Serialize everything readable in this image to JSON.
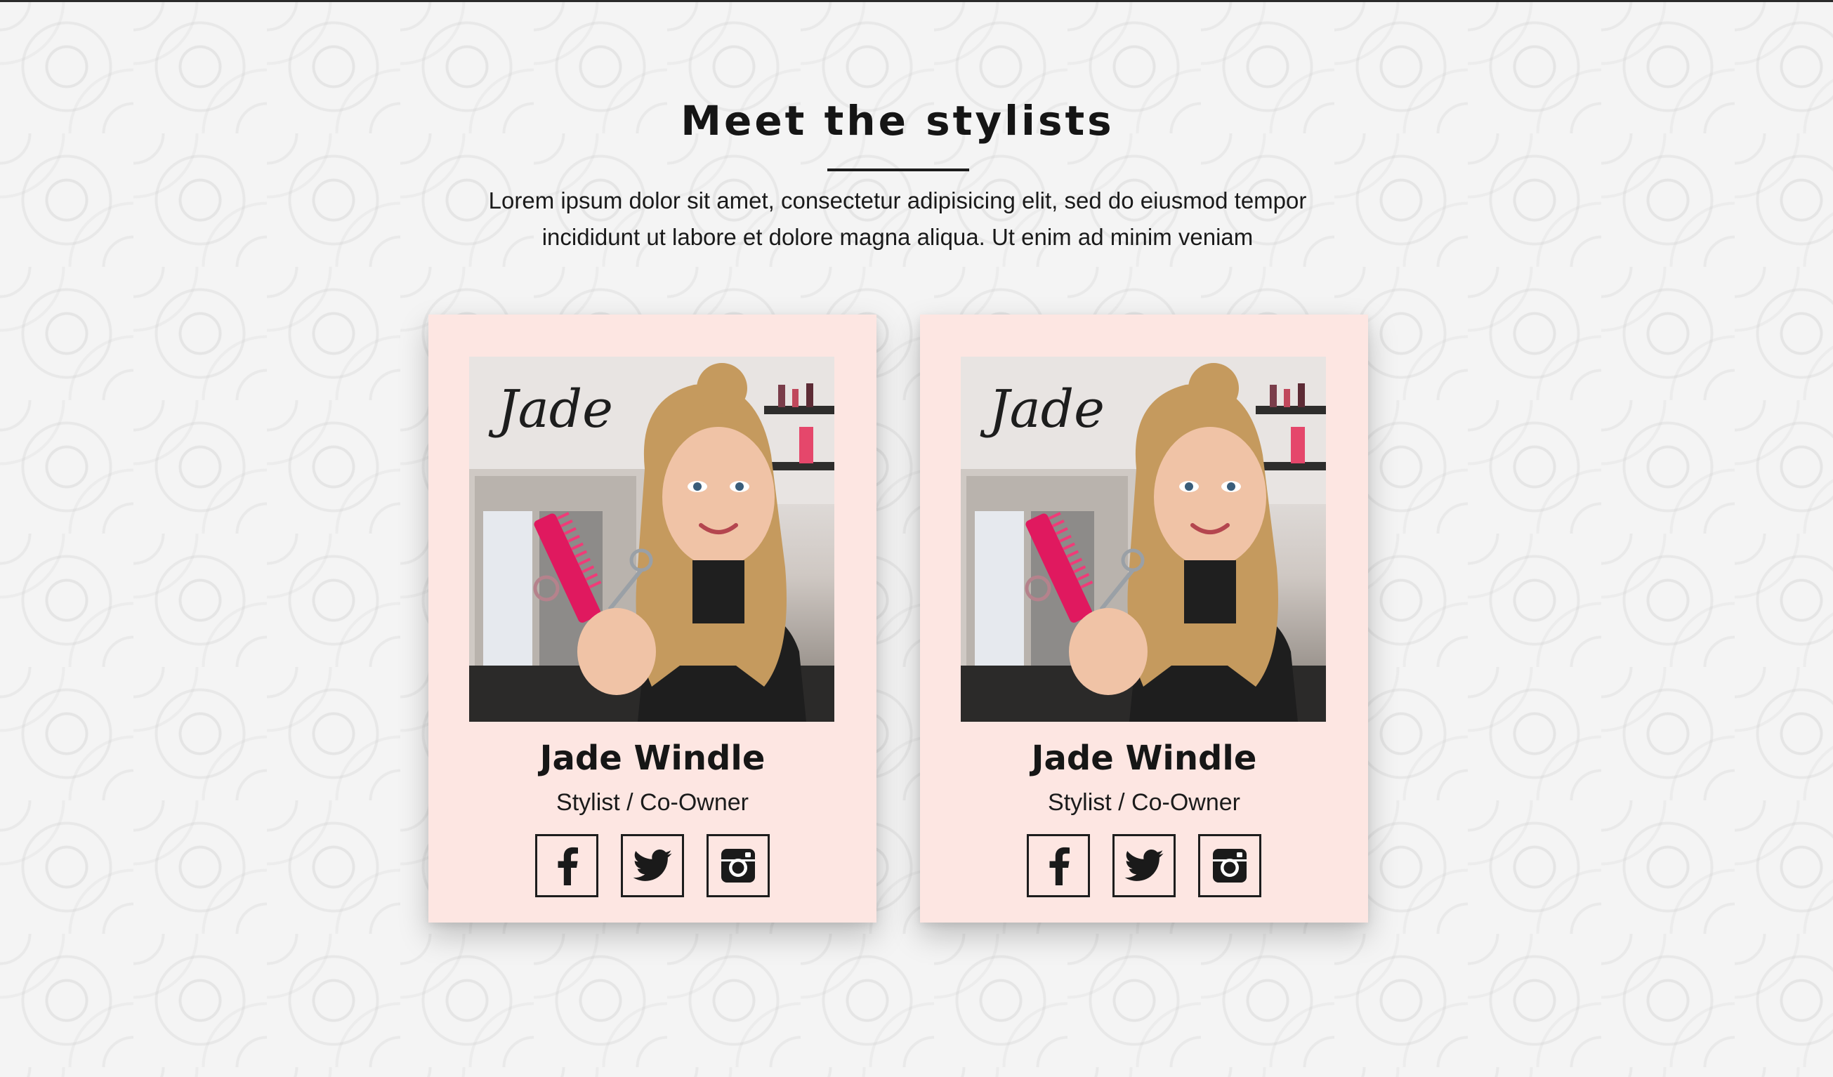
{
  "section": {
    "title": "Meet the stylists",
    "intro_line1": "Lorem ipsum dolor sit amet, consectetur adipisicing elit, sed do eiusmod tempor",
    "intro_line2": "incididunt ut labore et dolore magna aliqua. Ut enim ad minim veniam"
  },
  "stylists": [
    {
      "name": "Jade Windle",
      "role": "Stylist / Co-Owner",
      "photo_sign_text": "Jade",
      "social": [
        "facebook-icon",
        "twitter-icon",
        "instagram-icon"
      ]
    },
    {
      "name": "Jade Windle",
      "role": "Stylist / Co-Owner",
      "photo_sign_text": "Jade",
      "social": [
        "facebook-icon",
        "twitter-icon",
        "instagram-icon"
      ]
    }
  ],
  "colors": {
    "card_background": "#fde6e2",
    "text": "#161616",
    "comb_accent": "#e0195f"
  }
}
